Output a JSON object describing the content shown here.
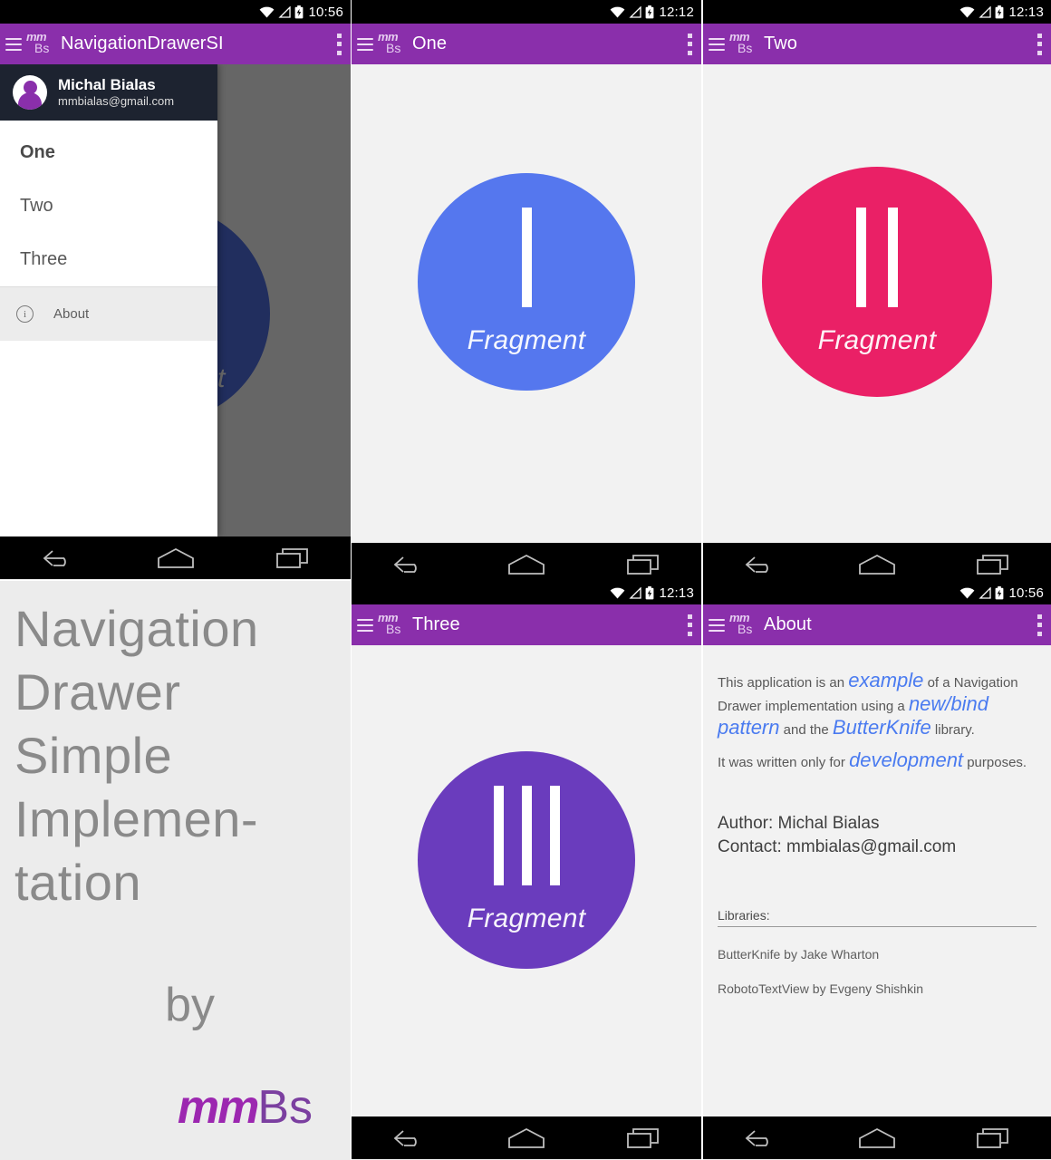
{
  "app": {
    "logo_top": "mm",
    "logo_bottom": "Bs",
    "accent_purple": "#8a2fab",
    "background": "#eeeeee"
  },
  "panels": {
    "drawer": {
      "status": {
        "time": "10:56"
      },
      "appbar": {
        "title": "NavigationDrawerSI"
      },
      "header": {
        "name": "Michal Bialas",
        "email": "mmbialas@gmail.com"
      },
      "items": [
        {
          "label": "One",
          "selected": true
        },
        {
          "label": "Two",
          "selected": false
        },
        {
          "label": "Three",
          "selected": false
        }
      ],
      "footer": {
        "label": "About",
        "icon": "info-icon"
      },
      "behind": {
        "label": "Fragment",
        "color": "#4f6fe0"
      }
    },
    "one": {
      "status": {
        "time": "12:12"
      },
      "appbar": {
        "title": "One"
      },
      "fragment": {
        "label": "Fragment",
        "color": "#5577ee",
        "bars": 1
      }
    },
    "two": {
      "status": {
        "time": "12:13"
      },
      "appbar": {
        "title": "Two"
      },
      "fragment": {
        "label": "Fragment",
        "color": "#ea2066",
        "bars": 2
      }
    },
    "three": {
      "status": {
        "time": "12:13"
      },
      "appbar": {
        "title": "Three"
      },
      "fragment": {
        "label": "Fragment",
        "color": "#6a3cbd",
        "bars": 3
      }
    },
    "branding": {
      "lines": "Navigation Drawer Simple Implemen-tation",
      "by": "by",
      "logo_mm": "mm",
      "logo_bs": "Bs"
    },
    "about": {
      "status": {
        "time": "10:56"
      },
      "appbar": {
        "title": "About"
      },
      "p1_a": "This application is an ",
      "p1_hl1": "example",
      "p1_b": " of a Navigation Drawer implementation using a ",
      "p1_hl2": "new/bind pattern",
      "p1_c": " and the ",
      "p1_hl3": "ButterKnife",
      "p1_d": " library.",
      "p2_a": "It was written only for ",
      "p2_hl": "development",
      "p2_b": " purposes.",
      "author": "Author: Michal Bialas",
      "contact": "Contact: mmbialas@gmail.com",
      "libs_title": "Libraries:",
      "libs": [
        "ButterKnife by Jake Wharton",
        "RobotoTextView by Evgeny Shishkin"
      ]
    }
  }
}
